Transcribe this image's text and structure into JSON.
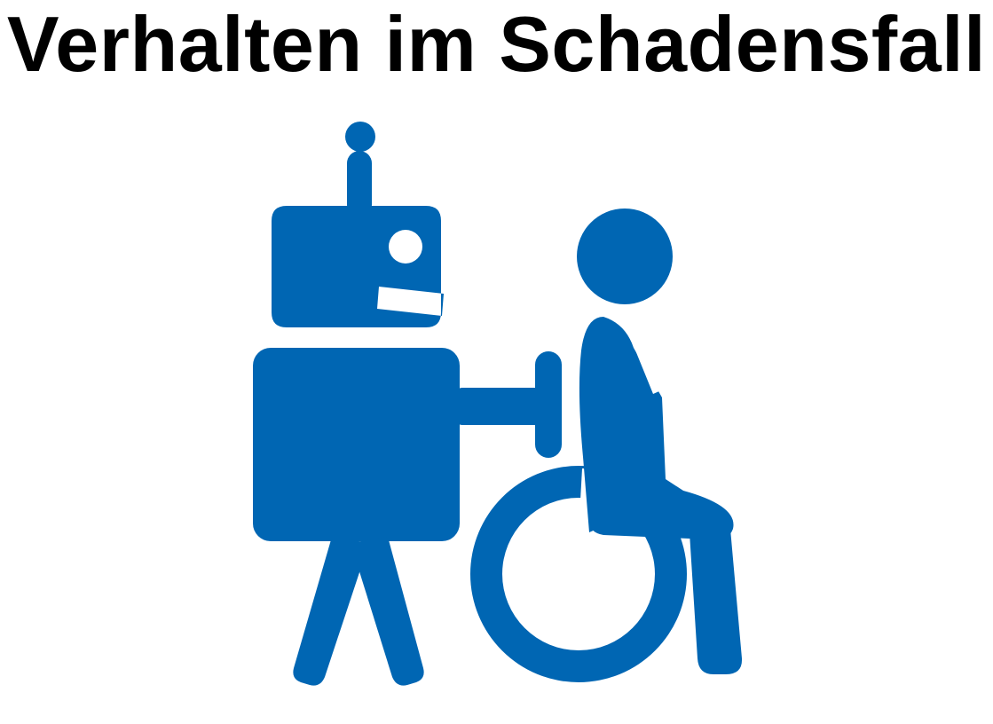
{
  "title": "Verhalten im Schadensfall",
  "illustration": {
    "icon": "robot-pushing-wheelchair-icon",
    "color": "#0066b3",
    "background": "#ffffff"
  }
}
